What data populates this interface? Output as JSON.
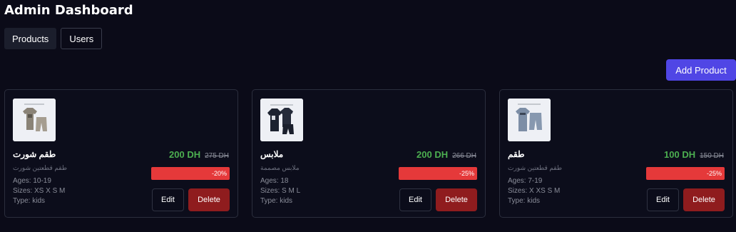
{
  "header": {
    "title": "Admin Dashboard"
  },
  "tabs": [
    {
      "label": "Products",
      "active": true
    },
    {
      "label": "Users",
      "active": false
    }
  ],
  "add_button": "Add Product",
  "colors": {
    "accent": "#5046e5",
    "price": "#4caf50",
    "discount": "#e5393a",
    "delete": "#8f1c1e"
  },
  "products": [
    {
      "name": "طقم شورت",
      "subtitle": "طقم قطعتين شورت",
      "ages": "Ages: 10-19",
      "sizes": "Sizes: XS X S M",
      "type": "Type: kids",
      "price": "200 DH",
      "old_price": "275 DH",
      "discount": "-20%",
      "edit": "Edit",
      "delete": "Delete",
      "image_icon": "clothing-set-beige-icon"
    },
    {
      "name": "ملابس",
      "subtitle": "ملابس مصممة",
      "ages": "Ages: 18",
      "sizes": "Sizes: S M L",
      "type": "Type: kids",
      "price": "200 DH",
      "old_price": "266 DH",
      "discount": "-25%",
      "edit": "Edit",
      "delete": "Delete",
      "image_icon": "clothing-set-black-icon"
    },
    {
      "name": "طقم",
      "subtitle": "طقم قطعتين شورت",
      "ages": "Ages: 7-19",
      "sizes": "Sizes: X XS S M",
      "type": "Type: kids",
      "price": "100 DH",
      "old_price": "150 DH",
      "discount": "-25%",
      "edit": "Edit",
      "delete": "Delete",
      "image_icon": "clothing-set-grey-icon"
    }
  ]
}
